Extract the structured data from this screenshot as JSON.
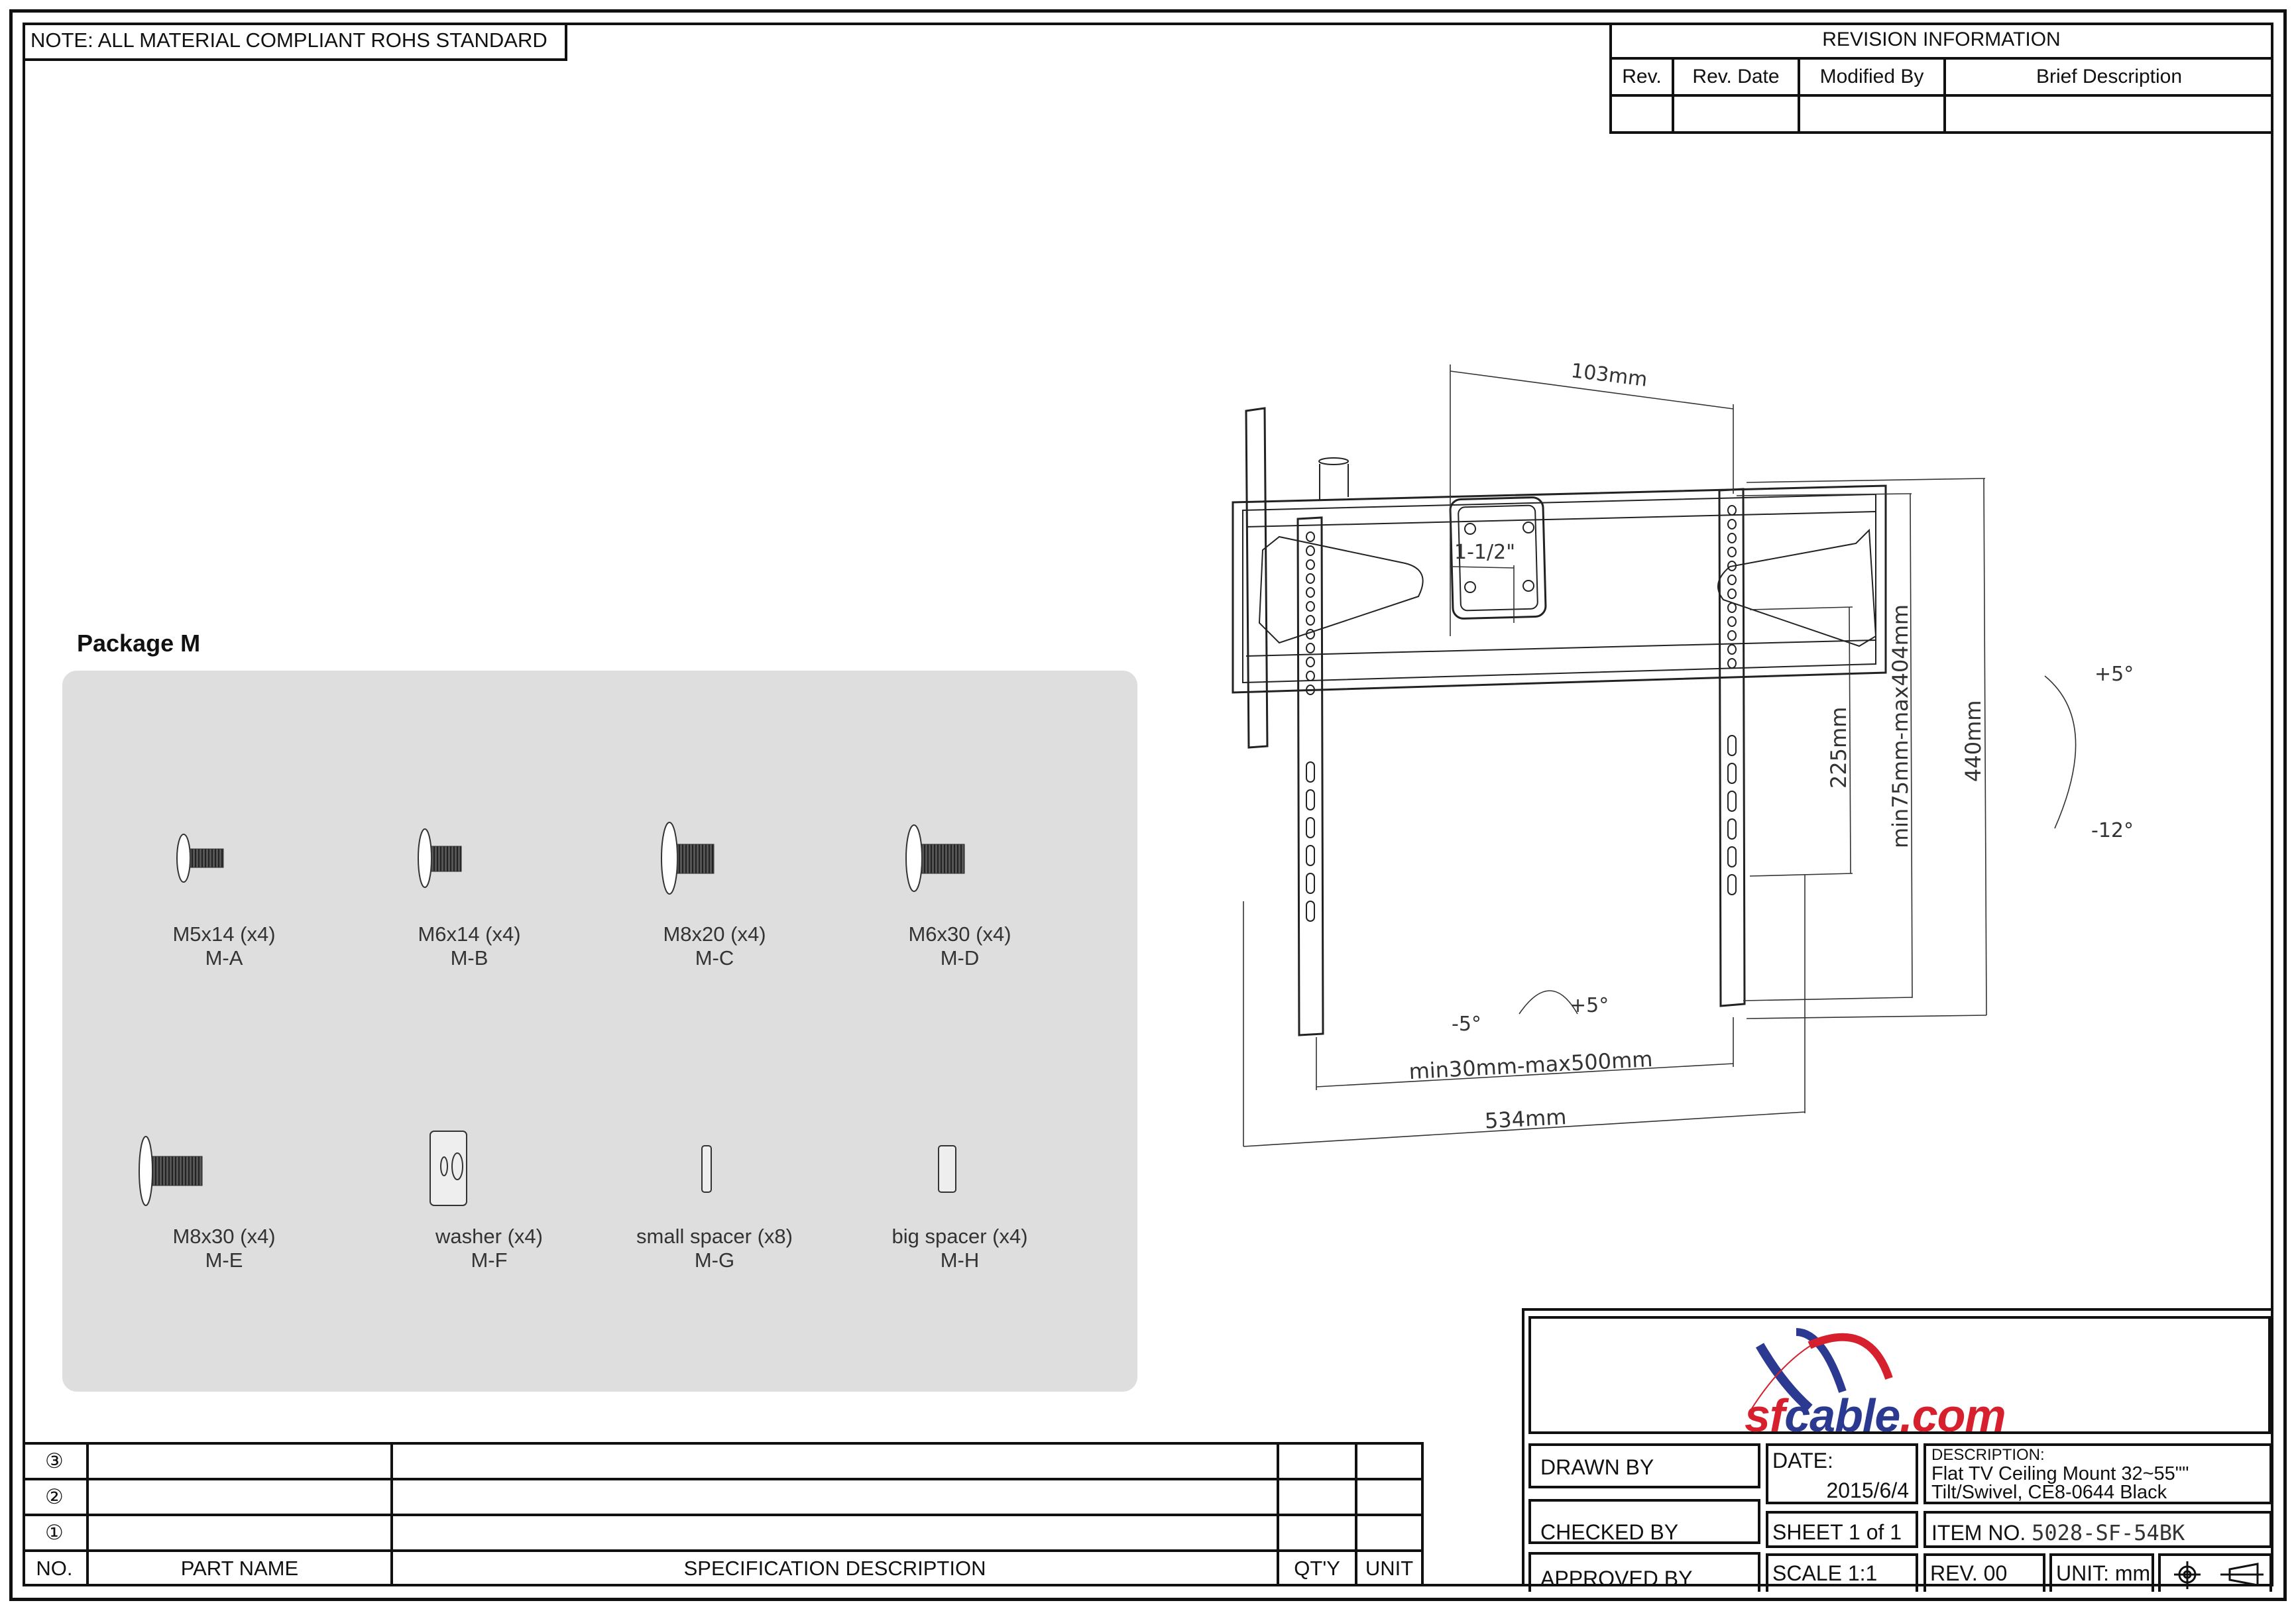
{
  "note": "NOTE: ALL MATERIAL COMPLIANT ROHS STANDARD",
  "revision": {
    "title": "REVISION INFORMATION",
    "headers": [
      "Rev.",
      "Rev. Date",
      "Modified By",
      "Brief Description"
    ],
    "rows": [
      [
        "",
        "",
        "",
        ""
      ]
    ]
  },
  "package": {
    "title": "Package M",
    "items": [
      {
        "spec": "M5x14 (x4)",
        "code": "M-A",
        "icon": "screw-icon"
      },
      {
        "spec": "M6x14 (x4)",
        "code": "M-B",
        "icon": "screw-icon"
      },
      {
        "spec": "M8x20 (x4)",
        "code": "M-C",
        "icon": "screw-icon"
      },
      {
        "spec": "M6x30 (x4)",
        "code": "M-D",
        "icon": "screw-icon"
      },
      {
        "spec": "M8x30 (x4)",
        "code": "M-E",
        "icon": "screw-icon"
      },
      {
        "spec": "washer (x4)",
        "code": "M-F",
        "icon": "washer-icon"
      },
      {
        "spec": "small spacer (x8)",
        "code": "M-G",
        "icon": "small-spacer-icon"
      },
      {
        "spec": "big spacer (x4)",
        "code": "M-H",
        "icon": "big-spacer-icon"
      }
    ]
  },
  "drawing": {
    "dimensions": {
      "top_offset": "103mm",
      "pole": "1-1/2\"",
      "height_225": "225mm",
      "vesa_vertical": "min75mm-max404mm",
      "height_440": "440mm",
      "tilt_up": "+5°",
      "tilt_down": "-12°",
      "swivel_left": "-5°",
      "swivel_right": "+5°",
      "vesa_horizontal": "min30mm-max500mm",
      "width_534": "534mm"
    }
  },
  "parts_table": {
    "rows": [
      {
        "no": "③",
        "part": "",
        "spec": "",
        "qty": "",
        "unit": ""
      },
      {
        "no": "②",
        "part": "",
        "spec": "",
        "qty": "",
        "unit": ""
      },
      {
        "no": "①",
        "part": "",
        "spec": "",
        "qty": "",
        "unit": ""
      }
    ],
    "headers": {
      "no": "NO.",
      "part": "PART NAME",
      "spec": "SPECIFICATION DESCRIPTION",
      "qty": "QT'Y",
      "unit": "UNIT"
    }
  },
  "title_block": {
    "logo_text_1": "sfcable",
    "logo_text_2": ".com",
    "brand_colors": {
      "red": "#d7202e",
      "blue": "#2b3990"
    },
    "drawn_by": "DRAWN BY",
    "checked_by": "CHECKED BY",
    "approved_by": "APPROVED BY",
    "date_label": "DATE:",
    "date_value": "2015/6/4",
    "description_label": "DESCRIPTION:",
    "description_line1": "Flat TV Ceiling Mount 32~55\"\"",
    "description_line2": "Tilt/Swivel, CE8-0644 Black",
    "sheet": "SHEET 1 of 1",
    "item_label": "ITEM NO.",
    "item_value": "5028-SF-54BK",
    "scale": "SCALE 1:1",
    "rev": "REV. 00",
    "unit": "UNIT: mm"
  }
}
